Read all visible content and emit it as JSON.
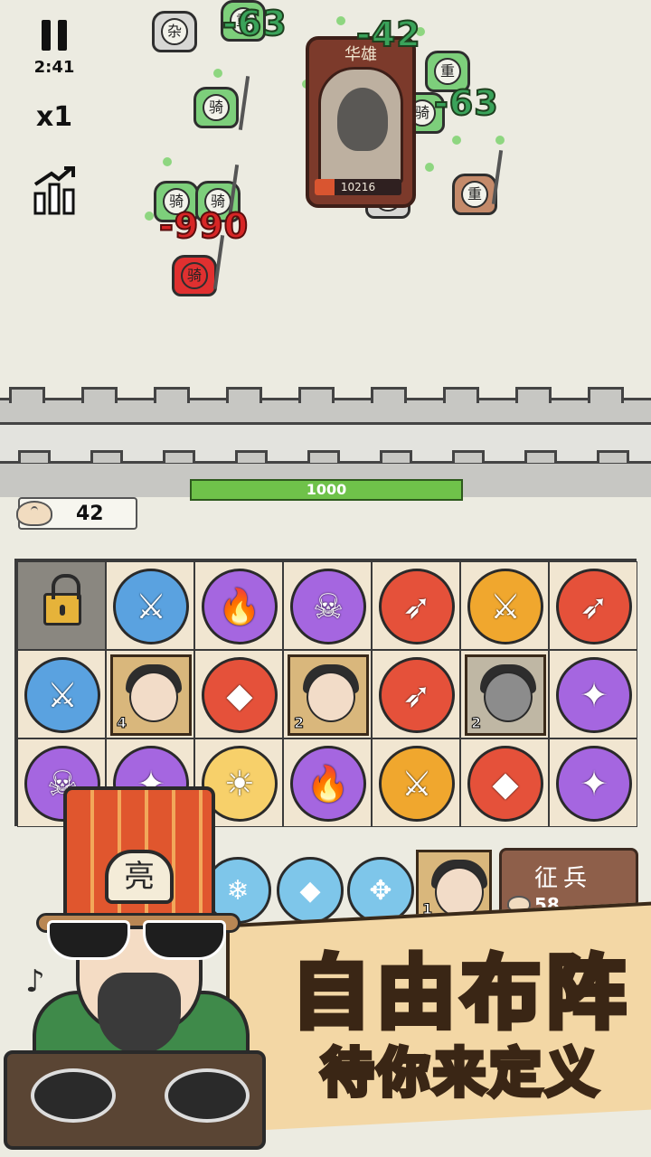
{
  "hud": {
    "timer": "2:41",
    "speed": "x1",
    "icons": [
      "pause-icon",
      "stats-icon"
    ]
  },
  "battlefield": {
    "damage_numbers": [
      "-63",
      "-42",
      "-63",
      "-990"
    ],
    "unit_glyphs": [
      "杂",
      "骑",
      "骑",
      "骑",
      "骑",
      "重",
      "重",
      "骑",
      "重"
    ],
    "boss": {
      "name": "华雄",
      "hp": "10216"
    }
  },
  "wall": {
    "hp": "1000"
  },
  "resources": {
    "buns": "42"
  },
  "grid": {
    "hero_levels": [
      "4",
      "2",
      "2",
      "1"
    ]
  },
  "recruit": {
    "label": "征兵",
    "cost": "58"
  },
  "banner": {
    "title": "自由布阵",
    "subtitle": "待你来定义"
  },
  "character": {
    "badge": "亮"
  },
  "colors": {
    "background": "#ecebe1",
    "wall_hp": "#6fc24a",
    "banner_title": "#f9c347",
    "damage_green": "#3aa35a",
    "damage_red": "#d72626"
  }
}
